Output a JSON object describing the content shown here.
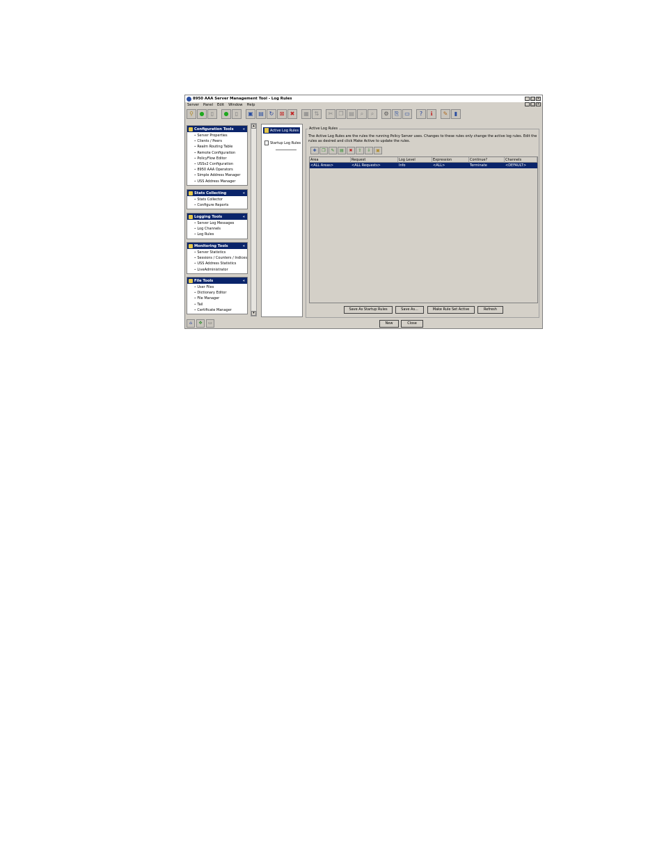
{
  "window": {
    "title": "8950 AAA Server Management Tool - Log Rules",
    "controls": [
      "_",
      "□",
      "×"
    ]
  },
  "menu": [
    "Server",
    "Panel",
    "Edit",
    "Window",
    "Help"
  ],
  "toolbar_icons": [
    "connect-icon",
    "green-light-icon",
    "page-icon",
    "green-light-icon",
    "page-icon",
    "save-icon",
    "save-as-icon",
    "refresh-icon",
    "close-panel-icon",
    "delete-icon",
    "print-icon",
    "sync-icon",
    "cut-icon",
    "copy-icon",
    "paste-icon",
    "find-icon",
    "find-next-icon",
    "settings-icon",
    "export-icon",
    "monitor-icon",
    "help-icon",
    "info-icon",
    "tools-icon",
    "database-icon"
  ],
  "nav": {
    "sections": [
      {
        "title": "Configuration Tools",
        "items": [
          "Server Properties",
          "Clients / Peers",
          "Realm Routing Table",
          "Remote Configuration",
          "PolicyFlow Editor",
          "USSv2 Configuration",
          "8950 AAA Operators",
          "Simple Address Manager",
          "USS Address Manager"
        ]
      },
      {
        "title": "Stats Collecting",
        "items": [
          "Stats Collector",
          "Configure Reports"
        ]
      },
      {
        "title": "Logging Tools",
        "items": [
          "Server Log Messages",
          "Log Channels",
          "Log Rules"
        ]
      },
      {
        "title": "Monitoring Tools",
        "items": [
          "Server Statistics",
          "Sessions / Counters / Indices",
          "USS Address Statistics",
          "LiveAdministrator"
        ]
      },
      {
        "title": "File Tools",
        "items": [
          "User Files",
          "Dictionary Editor",
          "File Manager",
          "Tail",
          "Certificate Manager"
        ]
      }
    ],
    "collapse_glyph": "«"
  },
  "tree": {
    "items": [
      "Active Log Rules",
      "Startup Log Rules"
    ]
  },
  "panel": {
    "group_title": "Active Log Rules",
    "description": "The Active Log Rules are the rules the running Policy Server uses. Changes to these rules only change the active log rules. Edit the rules as desired and click Make Active to update the rules.",
    "columns": [
      "Area",
      "Request",
      "Log Level",
      "Expression",
      "Continue?",
      "Channels"
    ],
    "rows": [
      [
        "<ALL Areas>",
        "<ALL Requests>",
        "Info",
        "<ALL>",
        "Terminate",
        "<DEFAULT>"
      ]
    ],
    "buttons": {
      "save_startup": "Save As Startup Rules",
      "save_as": "Save As...",
      "make_active": "Make Rule Set Active",
      "refresh": "Refresh"
    }
  },
  "footer": {
    "new": "New",
    "close": "Close"
  }
}
